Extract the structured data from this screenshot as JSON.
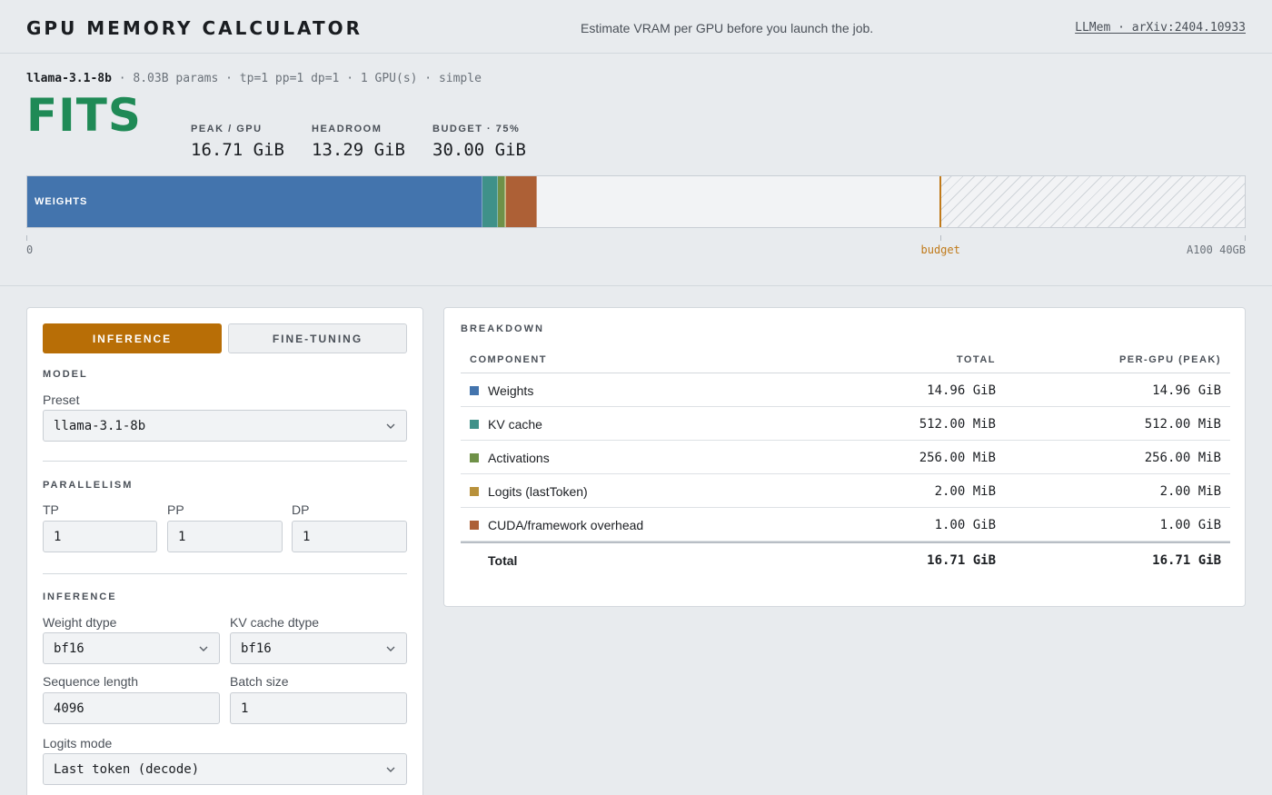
{
  "header": {
    "title": "GPU MEMORY CALCULATOR",
    "tagline": "Estimate VRAM per GPU before you launch the job.",
    "reference": "LLMem · arXiv:2404.10933"
  },
  "summary": {
    "model": "llama-3.1-8b",
    "details": " · 8.03B params · tp=1 pp=1 dp=1 · 1 GPU(s) · simple",
    "verdict": "FITS",
    "verdict_color": "#1f8a56",
    "stats": [
      {
        "label": "PEAK / GPU",
        "value": "16.71 GiB"
      },
      {
        "label": "HEADROOM",
        "value": "13.29 GiB"
      },
      {
        "label": "BUDGET · 75%",
        "value": "30.00 GiB"
      }
    ]
  },
  "memory_bar": {
    "capacity_gib": 40,
    "budget_gib": 30,
    "segments": [
      {
        "name": "weights",
        "label": "WEIGHTS",
        "gib": 14.96,
        "color": "#4374ad"
      },
      {
        "name": "kv-cache",
        "label": "",
        "gib": 0.5,
        "color": "#3f9189"
      },
      {
        "name": "activations",
        "label": "",
        "gib": 0.25,
        "color": "#6f9148"
      },
      {
        "name": "logits",
        "label": "",
        "gib": 0.002,
        "color": "#b8913b"
      },
      {
        "name": "overhead",
        "label": "",
        "gib": 1.0,
        "color": "#ad6036"
      }
    ],
    "axis": {
      "start": "0",
      "budget": "budget",
      "end": "A100 40GB"
    }
  },
  "controls": {
    "modes": {
      "inference": "INFERENCE",
      "finetuning": "FINE-TUNING",
      "active": "inference"
    },
    "model_group": "MODEL",
    "preset_label": "Preset",
    "preset_value": "llama-3.1-8b",
    "parallelism_group": "PARALLELISM",
    "tp_label": "TP",
    "tp_value": "1",
    "pp_label": "PP",
    "pp_value": "1",
    "dp_label": "DP",
    "dp_value": "1",
    "inference_group": "INFERENCE",
    "weight_dtype_label": "Weight dtype",
    "weight_dtype_value": "bf16",
    "kv_dtype_label": "KV cache dtype",
    "kv_dtype_value": "bf16",
    "seq_len_label": "Sequence length",
    "seq_len_value": "4096",
    "batch_label": "Batch size",
    "batch_value": "1",
    "logits_label": "Logits mode",
    "logits_value": "Last token (decode)"
  },
  "breakdown": {
    "title": "BREAKDOWN",
    "columns": [
      "COMPONENT",
      "TOTAL",
      "PER-GPU (PEAK)"
    ],
    "rows": [
      {
        "name": "Weights",
        "total": "14.96 GiB",
        "per_gpu": "14.96 GiB",
        "color": "#4374ad"
      },
      {
        "name": "KV cache",
        "total": "512.00 MiB",
        "per_gpu": "512.00 MiB",
        "color": "#3f9189"
      },
      {
        "name": "Activations",
        "total": "256.00 MiB",
        "per_gpu": "256.00 MiB",
        "color": "#6f9148"
      },
      {
        "name": "Logits (lastToken)",
        "total": "2.00 MiB",
        "per_gpu": "2.00 MiB",
        "color": "#b8913b"
      },
      {
        "name": "CUDA/framework overhead",
        "total": "1.00 GiB",
        "per_gpu": "1.00 GiB",
        "color": "#ad6036"
      }
    ],
    "total": {
      "name": "Total",
      "total": "16.71 GiB",
      "per_gpu": "16.71 GiB"
    }
  }
}
